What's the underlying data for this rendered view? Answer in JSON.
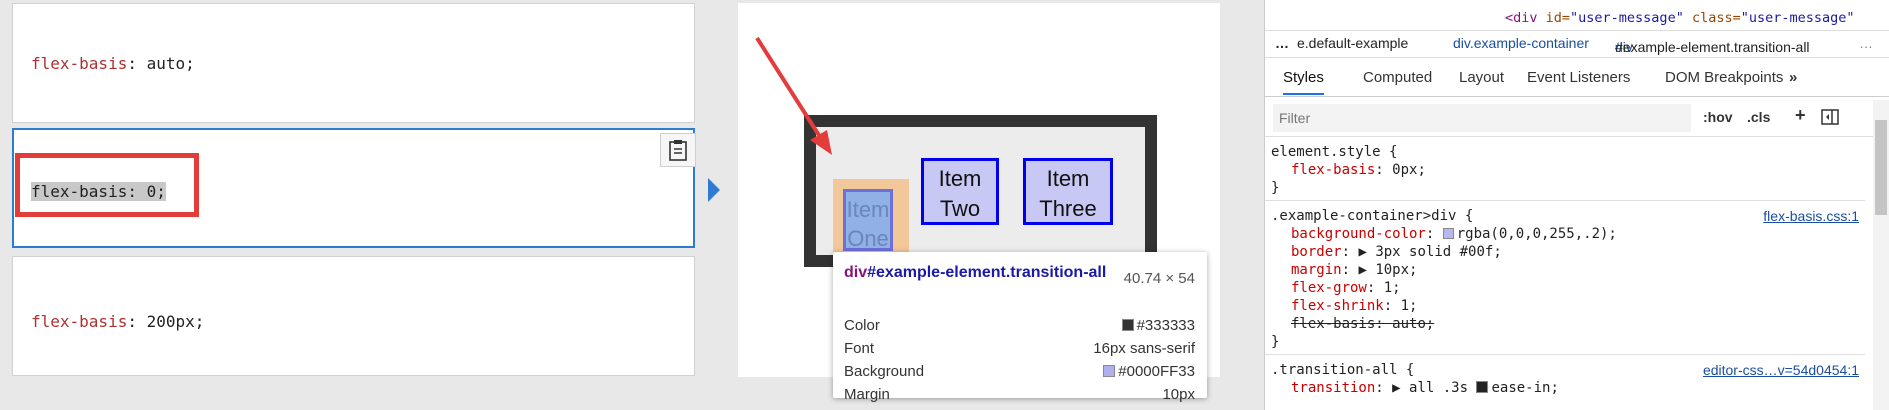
{
  "choices": [
    {
      "prop": "flex-basis",
      "value": " auto;"
    },
    {
      "prop": "flex-basis",
      "value": " 0;",
      "full": "flex-basis: 0;"
    },
    {
      "prop": "flex-basis",
      "value": " 200px;"
    }
  ],
  "preview": {
    "items": [
      {
        "line1": "Item",
        "line2": "One"
      },
      {
        "line1": "Item",
        "line2": "Two"
      },
      {
        "line1": "Item",
        "line2": "Three"
      }
    ]
  },
  "tooltip": {
    "tag": "div",
    "id_class": "#example-element.transition-all",
    "size": "40.74 × 54",
    "rows": [
      {
        "label": "Color",
        "value": "#333333",
        "swatch": "#333333"
      },
      {
        "label": "Font",
        "value": "16px sans-serif"
      },
      {
        "label": "Background",
        "value": "#0000FF33",
        "swatch": "#b0b0f0"
      },
      {
        "label": "Margin",
        "value": "10px"
      }
    ]
  },
  "devtools": {
    "dom": {
      "tag": "<div",
      "attr1": " id=",
      "val1": "\"user-message\"",
      "attr2": " class=",
      "val2": "\"user-message\""
    },
    "breadcrumbs": {
      "more": "…",
      "c1": "e.default-example",
      "c2": "div.example-container",
      "c3_tag": "div",
      "c3_rest": "#example-element.transition-all",
      "end": "…"
    },
    "tabs": [
      "Styles",
      "Computed",
      "Layout",
      "Event Listeners",
      "DOM Breakpoints",
      "»"
    ],
    "filter_placeholder": "Filter",
    "filter_buttons": {
      "hov": ":hov",
      "cls": ".cls",
      "plus": "+"
    },
    "rules": {
      "element_style": {
        "selector": "element.style {",
        "prop": "flex-basis",
        "value": ": 0px;"
      },
      "example": {
        "selector": ".example-container>div {",
        "source": "flex-basis.css:1",
        "decls": [
          {
            "prop": "background-color",
            "value": "rgba(0,0,0,255,.2);"
          },
          {
            "prop": "border",
            "value": "3px solid #00f;"
          },
          {
            "prop": "margin",
            "value": "10px;"
          },
          {
            "prop": "flex-grow",
            "value": "1;"
          },
          {
            "prop": "flex-shrink",
            "value": "1;"
          },
          {
            "prop": "flex-basis",
            "value": "auto;",
            "struck": true
          }
        ]
      },
      "transition": {
        "selector": ".transition-all {",
        "source": "editor-css…v=54d0454:1",
        "prop": "transition",
        "value": "all .3s ",
        "timing": "ease-in;"
      }
    },
    "close_brace": "}"
  }
}
